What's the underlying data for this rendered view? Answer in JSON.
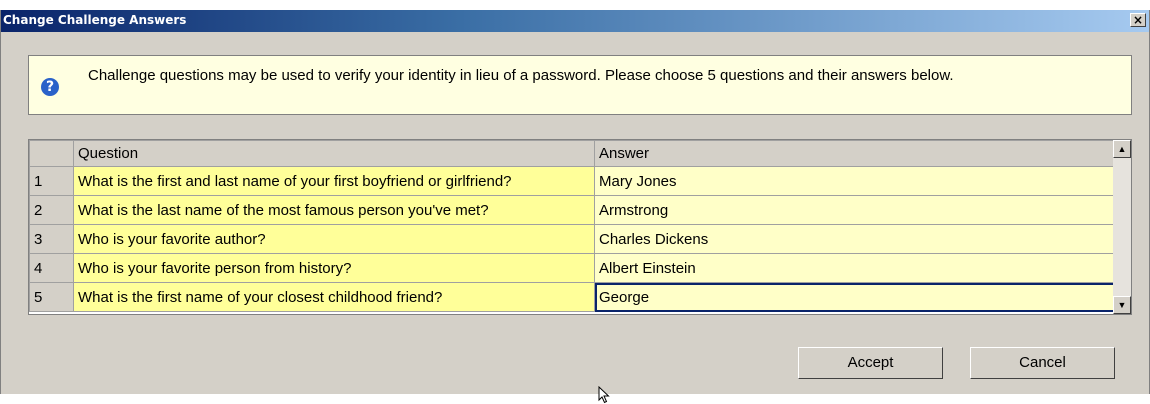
{
  "window": {
    "title": "Change Challenge Answers",
    "close_label": "×"
  },
  "info": {
    "icon": "question-icon",
    "text": "Challenge questions may be used to verify your identity in lieu of a password. Please choose 5 questions and their answers below."
  },
  "grid": {
    "columns": [
      "Question",
      "Answer"
    ],
    "rows": [
      {
        "num": "1",
        "question": "What is the first and last name of your first boyfriend or girlfriend?",
        "answer": "Mary Jones"
      },
      {
        "num": "2",
        "question": "What is the last name of the most famous person you've met?",
        "answer": "Armstrong"
      },
      {
        "num": "3",
        "question": "Who is your favorite author?",
        "answer": "Charles Dickens"
      },
      {
        "num": "4",
        "question": "Who is your favorite person from history?",
        "answer": "Albert Einstein"
      },
      {
        "num": "5",
        "question": "What is the first name of your closest childhood friend?",
        "answer": "George"
      }
    ]
  },
  "buttons": {
    "accept": "Accept",
    "cancel": "Cancel"
  }
}
